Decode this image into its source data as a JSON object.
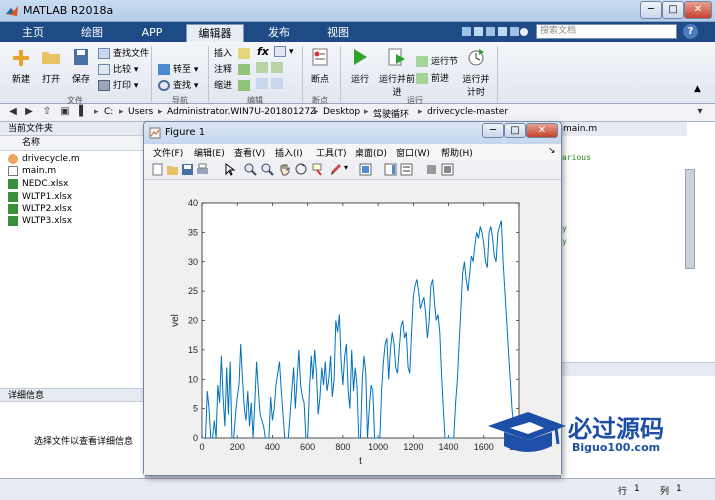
{
  "window": {
    "title": "MATLAB R2018a",
    "minimize": "─",
    "maximize": "□",
    "close": "✕"
  },
  "ribbon_tabs": [
    "主页",
    "绘图",
    "APP",
    "编辑器",
    "发布",
    "视图"
  ],
  "search": {
    "placeholder": "搜索文档"
  },
  "ribbon": {
    "file_group": {
      "new": "新建",
      "open": "打开",
      "save": "保存",
      "find_files": "查找文件",
      "compare": "比较",
      "print": "打印",
      "label": "文件"
    },
    "nav_group": {
      "goto": "转至",
      "find": "查找",
      "label": "导航"
    },
    "edit_group": {
      "insert": "插入",
      "comment": "注释",
      "indent": "缩进",
      "fx": "fx",
      "label": "编辑"
    },
    "breakpoint_group": {
      "breakpoints": "断点",
      "label": "断点"
    },
    "run_group": {
      "run": "运行",
      "run_advance": "运行并前进",
      "run_section": "运行节",
      "advance": "前进",
      "run_time": "运行并计时",
      "label": "运行"
    }
  },
  "address": {
    "crumbs": [
      "C:",
      "Users",
      "Administrator.WIN7U-20180127Z",
      "Desktop",
      "驾驶循环",
      "drivecycle-master"
    ]
  },
  "current_folder": {
    "title": "当前文件夹",
    "column": "名称",
    "files": [
      {
        "name": "drivecycle.m",
        "icon": "matlab-file-icon"
      },
      {
        "name": "main.m",
        "icon": "script-file-icon"
      },
      {
        "name": "NEDC.xlsx",
        "icon": "excel-file-icon"
      },
      {
        "name": "WLTP1.xlsx",
        "icon": "excel-file-icon"
      },
      {
        "name": "WLTP2.xlsx",
        "icon": "excel-file-icon"
      },
      {
        "name": "WLTP3.xlsx",
        "icon": "excel-file-icon"
      }
    ]
  },
  "details": {
    "title": "详细信息",
    "text": "选择文件以查看详细信息"
  },
  "editor": {
    "tab": "main.m",
    "code_fragments": [
      "arious",
      "y",
      "y"
    ]
  },
  "status": {
    "row_label": "行",
    "row": "1",
    "col_label": "列",
    "col": "1"
  },
  "figure": {
    "title": "Figure 1",
    "menus": [
      "文件(F)",
      "编辑(E)",
      "查看(V)",
      "插入(I)",
      "工具(T)",
      "桌面(D)",
      "窗口(W)",
      "帮助(H)"
    ]
  },
  "chart_data": {
    "type": "line",
    "xlabel": "t",
    "ylabel": "vel",
    "xlim": [
      0,
      1800
    ],
    "ylim": [
      0,
      40
    ],
    "xticks": [
      0,
      200,
      400,
      600,
      800,
      1000,
      1200,
      1400,
      1600,
      1800
    ],
    "yticks": [
      0,
      5,
      10,
      15,
      20,
      25,
      30,
      35,
      40
    ],
    "color": "#0072bd",
    "series": [
      {
        "x": [
          0,
          10,
          20,
          30,
          40,
          50,
          60,
          70,
          80,
          90,
          100,
          110,
          120,
          130,
          140,
          150,
          160,
          170,
          180,
          190,
          200,
          210,
          220,
          230,
          240,
          250,
          260,
          270,
          280,
          290,
          300,
          310,
          320,
          330,
          340,
          350,
          360,
          370,
          380,
          390,
          400,
          410,
          420,
          430,
          440,
          450,
          460,
          470,
          480,
          490,
          500,
          510,
          520,
          530,
          540,
          550,
          560,
          570,
          580,
          590,
          600,
          610,
          620,
          630,
          640,
          650,
          660,
          670,
          680,
          690,
          700,
          710,
          720,
          730,
          740,
          750,
          760,
          770,
          780,
          790,
          800,
          810,
          820,
          830,
          840,
          850,
          860,
          870,
          880,
          890,
          900,
          910,
          920,
          930,
          940,
          950,
          960,
          970,
          980,
          990,
          1000,
          1010,
          1020,
          1030,
          1040,
          1050,
          1060,
          1070,
          1080,
          1090,
          1100,
          1110,
          1120,
          1130,
          1140,
          1150,
          1160,
          1170,
          1180,
          1190,
          1200,
          1210,
          1220,
          1230,
          1240,
          1250,
          1260,
          1270,
          1280,
          1290,
          1300,
          1310,
          1320,
          1330,
          1340,
          1350,
          1360,
          1370,
          1380,
          1390,
          1400,
          1410,
          1420,
          1430,
          1440,
          1450,
          1460,
          1470,
          1480,
          1490,
          1500,
          1510,
          1520,
          1530,
          1540,
          1550,
          1560,
          1570,
          1580,
          1590,
          1600,
          1610,
          1620,
          1630,
          1640,
          1650,
          1660,
          1670,
          1680,
          1690,
          1700,
          1710,
          1720,
          1730,
          1740,
          1750,
          1760,
          1770,
          1780,
          1790,
          1800
        ],
        "y": [
          0,
          0,
          0,
          8,
          5,
          0,
          0,
          3,
          0,
          9,
          6,
          14,
          7,
          2,
          12,
          4,
          13,
          0,
          0,
          4,
          7,
          9,
          16,
          10,
          5,
          3,
          8,
          2,
          6,
          0,
          6,
          13,
          8,
          4,
          3,
          2,
          0,
          0,
          0,
          7,
          3,
          5,
          9,
          11,
          13,
          8,
          4,
          0,
          0,
          0,
          4,
          8,
          12,
          5,
          10,
          15,
          9,
          7,
          6,
          0,
          0,
          8,
          14,
          10,
          15,
          11,
          4,
          7,
          12,
          9,
          13,
          8,
          10,
          14,
          7,
          10,
          20,
          18,
          21,
          13,
          9,
          14,
          16,
          8,
          5,
          15,
          8,
          12,
          9,
          0,
          0,
          10,
          14,
          11,
          0,
          5,
          9,
          8,
          0,
          0,
          0,
          0,
          8,
          13,
          16,
          17,
          10,
          15,
          18,
          16,
          12,
          11,
          15,
          19,
          20,
          17,
          18,
          12,
          11,
          18,
          24,
          26,
          27,
          25,
          22,
          23,
          24,
          21,
          17,
          20,
          26,
          27,
          23,
          20,
          21,
          18,
          11,
          5,
          0,
          0,
          0,
          0,
          0,
          0,
          6,
          10,
          16,
          22,
          28,
          30,
          27,
          25,
          28,
          31,
          30,
          33,
          35,
          34,
          36,
          35,
          33,
          30,
          29,
          35,
          36,
          34,
          31,
          30,
          35,
          36,
          37,
          30,
          25,
          20,
          15,
          10,
          5,
          2,
          0,
          0,
          0
        ]
      }
    ]
  },
  "watermark": {
    "title": "必过源码",
    "subtitle": "Biguo100.com"
  }
}
